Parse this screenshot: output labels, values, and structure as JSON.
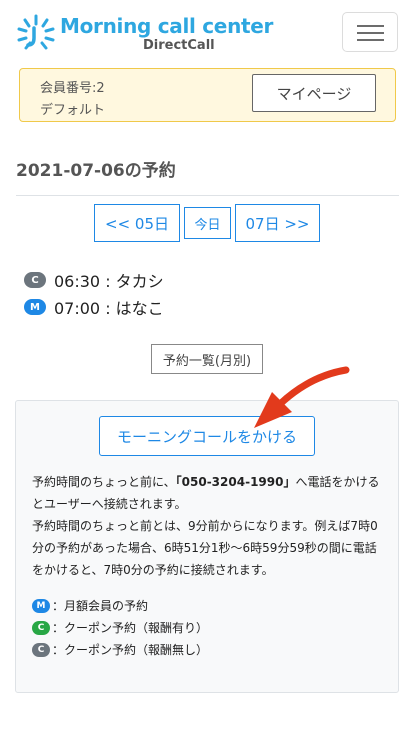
{
  "header": {
    "brand_main": "Morning call center",
    "brand_sub": "DirectCall",
    "logo_icon": "sunburst-logo-icon",
    "menu_icon": "hamburger-menu-icon",
    "brand_color": "#2ea7e0"
  },
  "member": {
    "number": "会員番号:2",
    "plan": "デフォルト",
    "mypage_label": "マイページ"
  },
  "page": {
    "title": "2021-07-06の予約"
  },
  "date_nav": {
    "prev_label": "<< 05日",
    "today_label": "今日",
    "next_label": "07日 >>"
  },
  "reservations": [
    {
      "badge": "C",
      "text": "06:30 : タカシ",
      "badge_color": "#6c757d"
    },
    {
      "badge": "M",
      "text": "07:00 : はなこ",
      "badge_color": "#1e88e5"
    }
  ],
  "monthly_list_label": "予約一覧(月別)",
  "info": {
    "call_button_label": "モーニングコールをかける",
    "desc_prefix": "予約時間のちょっと前に、",
    "phone": "「050-3204-1990」",
    "desc_suffix": "へ電話をかけるとユーザーへ接続されます。",
    "desc_detail": "予約時間のちょっと前とは、9分前からになります。例えば7時0分の予約があった場合、6時51分1秒〜6時59分59秒の間に電話をかけると、7時0分の予約に接続されます。",
    "legend": [
      {
        "badge": "M",
        "text": "：月額会員の予約",
        "badge_color": "#1e88e5"
      },
      {
        "badge": "C",
        "text": "：クーポン予約（報酬有り）",
        "badge_color": "#28a745"
      },
      {
        "badge": "C",
        "text": "：クーポン予約（報酬無し）",
        "badge_color": "#6c757d"
      }
    ]
  },
  "annotation": {
    "arrow_icon": "red-arrow-icon",
    "arrow_color": "#e23a1c"
  }
}
